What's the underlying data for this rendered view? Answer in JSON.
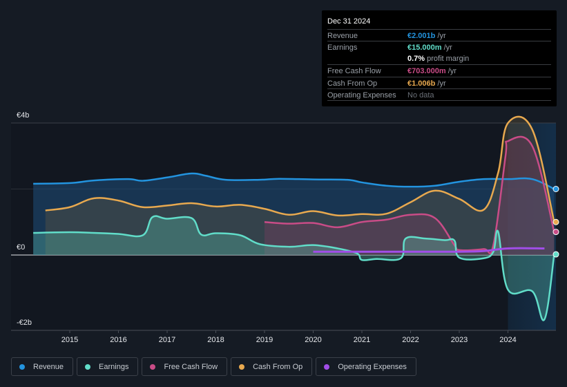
{
  "tooltip": {
    "date": "Dec 31 2024",
    "rows": [
      {
        "label": "Revenue",
        "value": "€2.001b",
        "unit": " /yr",
        "color": "#2394df"
      },
      {
        "label": "Earnings",
        "value": "€15.000m",
        "unit": " /yr",
        "color": "#61ddc9"
      },
      {
        "label": "",
        "value": "0.7%",
        "unit": " profit margin",
        "color": "#ffffff"
      },
      {
        "label": "Free Cash Flow",
        "value": "€703.000m",
        "unit": " /yr",
        "color": "#c94c87"
      },
      {
        "label": "Cash From Op",
        "value": "€1.006b",
        "unit": " /yr",
        "color": "#e8a94f"
      },
      {
        "label": "Operating Expenses",
        "value": "No data",
        "unit": "",
        "color": "#6b7078"
      }
    ]
  },
  "legend": [
    {
      "label": "Revenue",
      "color": "#2394df"
    },
    {
      "label": "Earnings",
      "color": "#61ddc9"
    },
    {
      "label": "Free Cash Flow",
      "color": "#c94c87"
    },
    {
      "label": "Cash From Op",
      "color": "#e8a94f"
    },
    {
      "label": "Operating Expenses",
      "color": "#a14ee8"
    }
  ],
  "chart_data": {
    "type": "area",
    "title": "",
    "xlabel": "",
    "ylabel": "",
    "y_tick_labels": [
      "€4b",
      "€0",
      "-€2b"
    ],
    "y_ticks": [
      4,
      0,
      -2
    ],
    "ylim": [
      -2.4,
      4.0
    ],
    "x_tick_labels": [
      "2015",
      "2016",
      "2017",
      "2018",
      "2019",
      "2020",
      "2021",
      "2022",
      "2023",
      "2024"
    ],
    "x_ticks": [
      2015,
      2016,
      2017,
      2018,
      2019,
      2020,
      2021,
      2022,
      2023,
      2024
    ],
    "xlim": [
      2013.8,
      2025.0
    ],
    "highlight_from": 2024.0,
    "units": "€b",
    "series": [
      {
        "name": "Revenue",
        "color": "#2394df",
        "x": [
          2014.25,
          2015.0,
          2015.5,
          2016.2,
          2016.5,
          2017.0,
          2017.5,
          2017.8,
          2018.2,
          2018.9,
          2019.3,
          2020.0,
          2020.7,
          2021.0,
          2021.5,
          2022.0,
          2022.5,
          2023.0,
          2023.5,
          2024.0,
          2024.5,
          2024.95
        ],
        "values": [
          2.16,
          2.18,
          2.26,
          2.3,
          2.25,
          2.35,
          2.47,
          2.4,
          2.28,
          2.28,
          2.31,
          2.29,
          2.28,
          2.2,
          2.1,
          2.07,
          2.1,
          2.22,
          2.3,
          2.3,
          2.3,
          2.0
        ]
      },
      {
        "name": "Earnings",
        "color": "#61ddc9",
        "x": [
          2014.25,
          2015.0,
          2015.5,
          2016.0,
          2016.5,
          2016.7,
          2017.0,
          2017.5,
          2017.7,
          2018.0,
          2018.5,
          2018.9,
          2019.5,
          2020.0,
          2020.5,
          2020.9,
          2021.0,
          2021.3,
          2021.8,
          2021.9,
          2022.3,
          2022.7,
          2022.9,
          2023.0,
          2023.5,
          2023.7,
          2023.8,
          2024.0,
          2024.5,
          2024.75,
          2024.95
        ],
        "values": [
          0.67,
          0.69,
          0.67,
          0.64,
          0.6,
          1.15,
          1.1,
          1.12,
          0.62,
          0.66,
          0.6,
          0.33,
          0.25,
          0.3,
          0.2,
          0.05,
          -0.15,
          -0.12,
          -0.1,
          0.5,
          0.5,
          0.45,
          0.44,
          -0.08,
          -0.1,
          0.1,
          0.7,
          -1.05,
          -1.1,
          -1.95,
          0.02
        ]
      },
      {
        "name": "Free Cash Flow",
        "color": "#c94c87",
        "x": [
          2019.0,
          2019.5,
          2020.0,
          2020.5,
          2021.0,
          2021.5,
          2022.0,
          2022.5,
          2022.9,
          2023.0,
          2023.5,
          2023.7,
          2023.95,
          2024.0,
          2024.5,
          2024.95
        ],
        "values": [
          1.0,
          0.95,
          0.97,
          0.84,
          1.0,
          1.07,
          1.22,
          1.12,
          0.3,
          0.15,
          0.18,
          0.3,
          3.0,
          3.45,
          3.3,
          0.7
        ]
      },
      {
        "name": "Cash From Op",
        "color": "#e8a94f",
        "x": [
          2014.5,
          2015.0,
          2015.5,
          2016.0,
          2016.5,
          2017.0,
          2017.5,
          2018.0,
          2018.5,
          2019.0,
          2019.5,
          2020.0,
          2020.5,
          2021.0,
          2021.5,
          2022.0,
          2022.5,
          2023.0,
          2023.5,
          2023.8,
          2024.0,
          2024.5,
          2024.95
        ],
        "values": [
          1.35,
          1.45,
          1.72,
          1.65,
          1.45,
          1.5,
          1.57,
          1.47,
          1.52,
          1.4,
          1.22,
          1.33,
          1.2,
          1.24,
          1.25,
          1.6,
          1.95,
          1.7,
          1.37,
          2.5,
          4.0,
          3.8,
          1.0
        ]
      },
      {
        "name": "Operating Expenses",
        "color": "#a14ee8",
        "x": [
          2020.0,
          2021.0,
          2022.0,
          2023.0,
          2023.5,
          2024.0,
          2024.75
        ],
        "values": [
          0.1,
          0.1,
          0.1,
          0.1,
          0.12,
          0.2,
          0.2
        ]
      }
    ]
  }
}
